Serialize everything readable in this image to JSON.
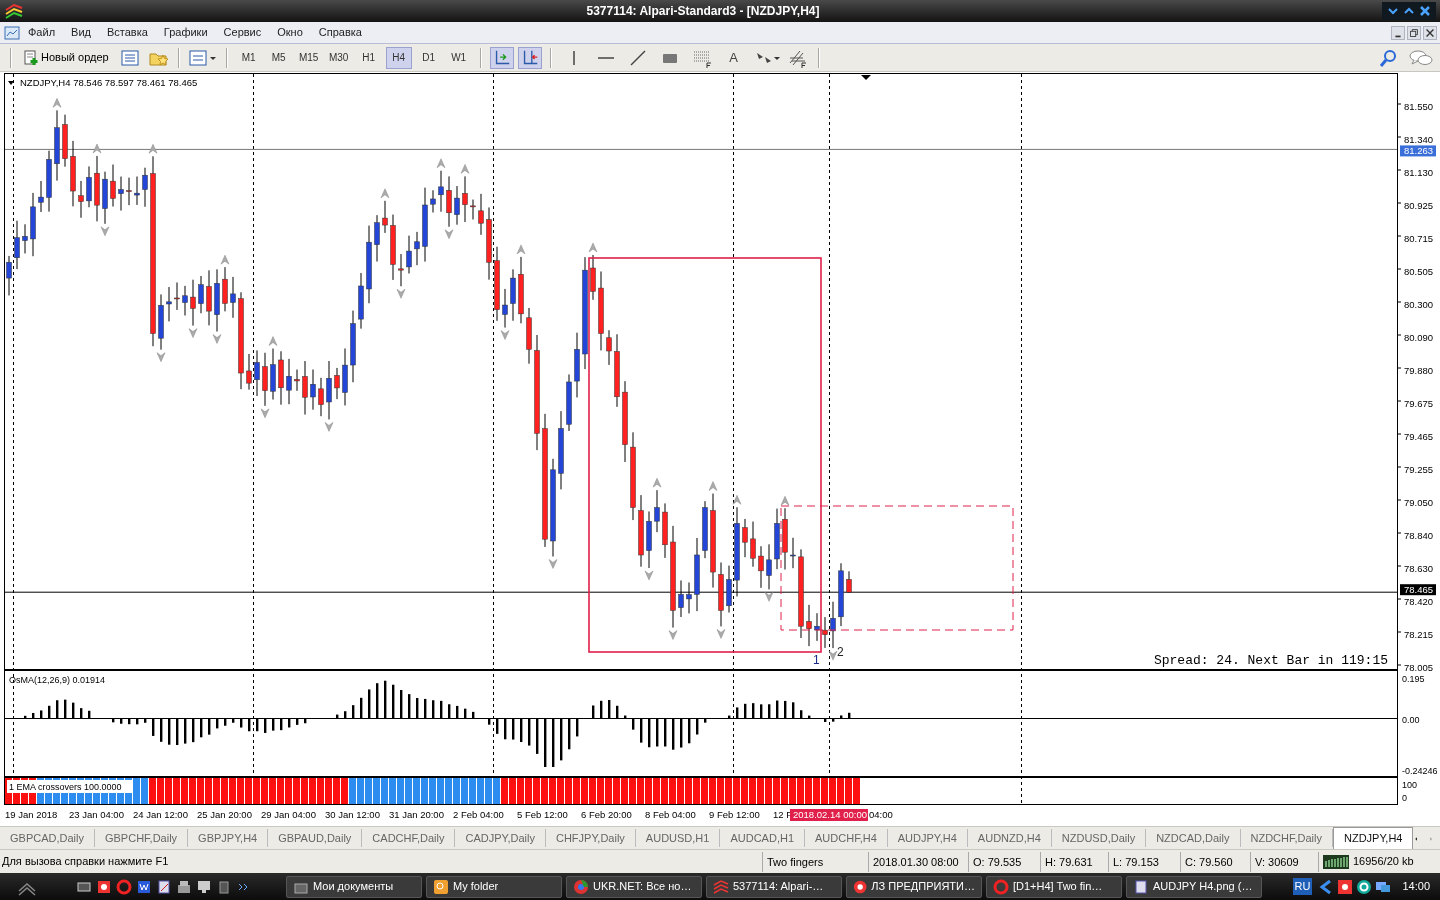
{
  "window": {
    "title": "5377114: Alpari-Standard3 - [NZDJPY,H4]"
  },
  "menu": [
    "Файл",
    "Вид",
    "Вставка",
    "Графики",
    "Сервис",
    "Окно",
    "Справка"
  ],
  "toolbar": {
    "new_order": "Новый ордер",
    "timeframes": [
      {
        "label": "M1",
        "selected": false
      },
      {
        "label": "M5",
        "selected": false
      },
      {
        "label": "M15",
        "selected": false
      },
      {
        "label": "M30",
        "selected": false
      },
      {
        "label": "H1",
        "selected": false
      },
      {
        "label": "H4",
        "selected": true
      },
      {
        "label": "D1",
        "selected": false
      },
      {
        "label": "W1",
        "selected": false
      }
    ],
    "toggles": [
      {
        "pressed": true
      },
      {
        "pressed": true
      }
    ],
    "text_tool": "A"
  },
  "chart": {
    "header": "NZDJPY,H4  78.546 78.597 78.461 78.465",
    "price_scale": [
      "81.550",
      "81.340",
      "81.130",
      "80.925",
      "80.715",
      "80.505",
      "80.300",
      "80.090",
      "79.880",
      "79.675",
      "79.465",
      "79.255",
      "79.050",
      "78.840",
      "78.630",
      "78.420",
      "78.215",
      "78.005"
    ],
    "line_price": "81.263",
    "current_price": "78.465",
    "wave_labels": [
      "1",
      "2"
    ],
    "info": "Spread: 24. Next Bar in 119:15"
  },
  "oscillator": {
    "label": "OsMA(12,26,9) 0.01914",
    "scale": [
      "0.195",
      "0.00",
      "-0.24246"
    ]
  },
  "signal_pane": {
    "label": "1 EMA crossovers 100.0000",
    "scale": [
      "100",
      "0"
    ]
  },
  "time_axis": {
    "labels": [
      "19 Jan 2018",
      "23 Jan 04:00",
      "24 Jan 12:00",
      "25 Jan 20:00",
      "29 Jan 04:00",
      "30 Jan 12:00",
      "31 Jan 20:00",
      "2 Feb 04:00",
      "5 Feb 12:00",
      "6 Feb 20:00",
      "8 Feb 04:00",
      "9 Feb 12:00",
      "12 F"
    ],
    "cursor_time": "2018.02.14 00:00",
    "after_cursor": "04:00"
  },
  "tabs": [
    {
      "label": "GBPCAD,Daily",
      "selected": false
    },
    {
      "label": "GBPCHF,Daily",
      "selected": false
    },
    {
      "label": "GBPJPY,H4",
      "selected": false
    },
    {
      "label": "GBPAUD,Daily",
      "selected": false
    },
    {
      "label": "CADCHF,Daily",
      "selected": false
    },
    {
      "label": "CADJPY,Daily",
      "selected": false
    },
    {
      "label": "CHFJPY,Daily",
      "selected": false
    },
    {
      "label": "AUDUSD,H1",
      "selected": false
    },
    {
      "label": "AUDCAD,H1",
      "selected": false
    },
    {
      "label": "AUDCHF,H4",
      "selected": false
    },
    {
      "label": "AUDJPY,H4",
      "selected": false
    },
    {
      "label": "AUDNZD,H4",
      "selected": false
    },
    {
      "label": "NZDUSD,Daily",
      "selected": false
    },
    {
      "label": "NZDCAD,Daily",
      "selected": false
    },
    {
      "label": "NZDCHF,Daily",
      "selected": false
    },
    {
      "label": "NZDJPY,H4",
      "selected": true
    }
  ],
  "status_bar": {
    "hint": "Для вызова справки нажмите F1",
    "cells": [
      "Two fingers",
      "2018.01.30 08:00",
      "O: 79.535",
      "H: 79.631",
      "L: 79.153",
      "C: 79.560",
      "V: 30609"
    ],
    "traffic": "16956/20 kb"
  },
  "taskbar": {
    "windows": [
      "Мои документы",
      "My folder",
      "UKR.NET: Все но…",
      "5377114: Alpari-…",
      "ЛЗ ПРЕДПРИЯТИ…",
      "[D1+H4] Two fin…",
      "AUDJPY H4.png (…"
    ],
    "language": "RU",
    "clock": "14:00"
  }
}
